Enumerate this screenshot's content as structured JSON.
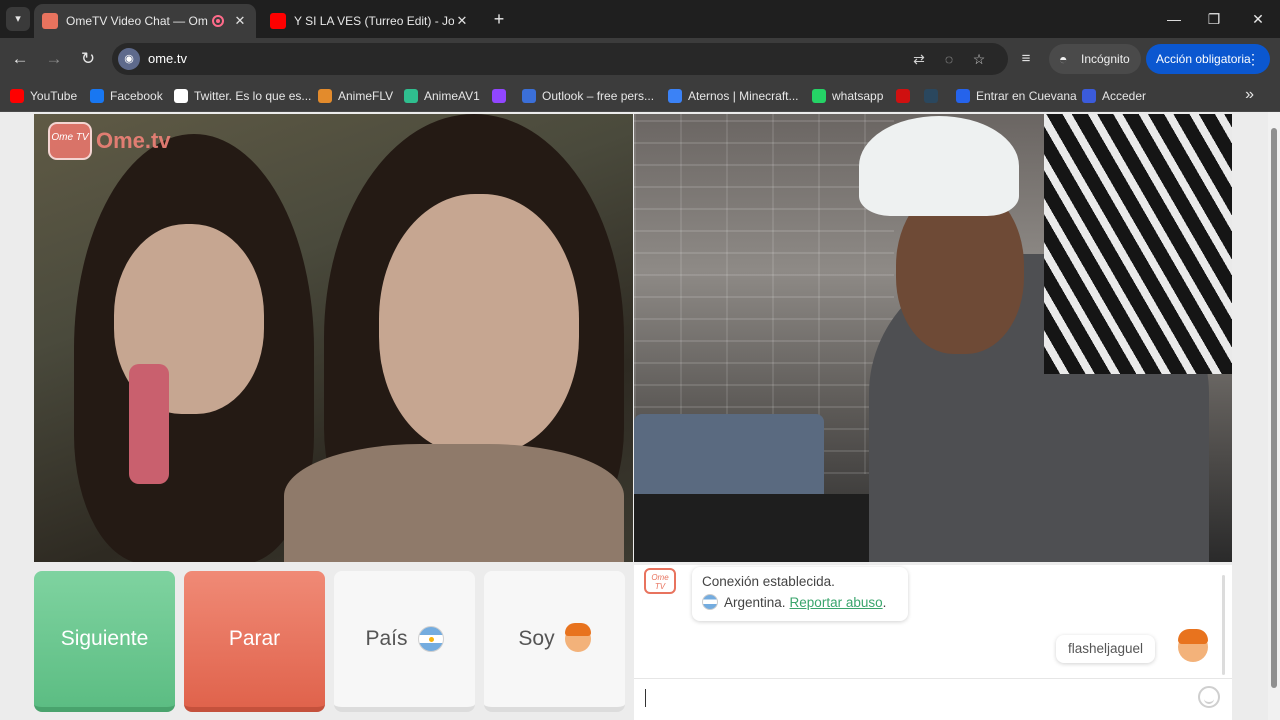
{
  "tabs": [
    {
      "title": "OmeTV Video Chat — Ome",
      "favicon": "ometv-favicon",
      "recording": true,
      "active": true
    },
    {
      "title": "Y SI LA VES (Turreo Edit) - Jona",
      "favicon": "youtube-favicon",
      "active": false
    }
  ],
  "toolbar": {
    "url": "ome.tv",
    "incognito_label": "Incógnito",
    "action_label": "Acción obligatoria"
  },
  "bookmarks": [
    {
      "label": "YouTube",
      "icon": "youtube-icon",
      "color": "#ff0000"
    },
    {
      "label": "Facebook",
      "icon": "facebook-icon",
      "color": "#1877f2"
    },
    {
      "label": "Twitter. Es lo que es...",
      "icon": "google-icon",
      "color": "#ffffff"
    },
    {
      "label": "AnimeFLV",
      "icon": "animeflv-icon",
      "color": "#e38b2c"
    },
    {
      "label": "AnimeAV1",
      "icon": "animeav1-icon",
      "color": "#2fbf8f"
    },
    {
      "label": "",
      "icon": "twitch-icon",
      "color": "#9146ff"
    },
    {
      "label": "Outlook – free pers...",
      "icon": "outlook-icon",
      "color": "#3b6fd8"
    },
    {
      "label": "Aternos | Minecraft...",
      "icon": "aternos-icon",
      "color": "#3b82f6"
    },
    {
      "label": "whatsapp",
      "icon": "whatsapp-icon",
      "color": "#25d366"
    },
    {
      "label": "",
      "icon": "red-bookmark-icon",
      "color": "#d01010"
    },
    {
      "label": "",
      "icon": "steam-icon",
      "color": "#2a475e"
    },
    {
      "label": "Entrar en Cuevana",
      "icon": "cuevana-icon",
      "color": "#2563eb"
    },
    {
      "label": "Acceder",
      "icon": "acceder-icon",
      "color": "#3b5bdb"
    }
  ],
  "brand": {
    "logo_small": "Ome TV",
    "logo_word": "Ome.tv"
  },
  "controls": {
    "next_label": "Siguiente",
    "stop_label": "Parar",
    "country_label": "País",
    "me_label": "Soy"
  },
  "chat": {
    "logo_text": "Ome TV",
    "connection_text": "Conexión establecida.",
    "country": "Argentina.",
    "report_link": "Reportar abuso",
    "report_suffix": ".",
    "username": "flasheljaguel"
  },
  "colors": {
    "next": "#5cbd83",
    "stop": "#e0634c",
    "accent_link": "#3aa56c",
    "incognito_action": "#0b57d0"
  }
}
